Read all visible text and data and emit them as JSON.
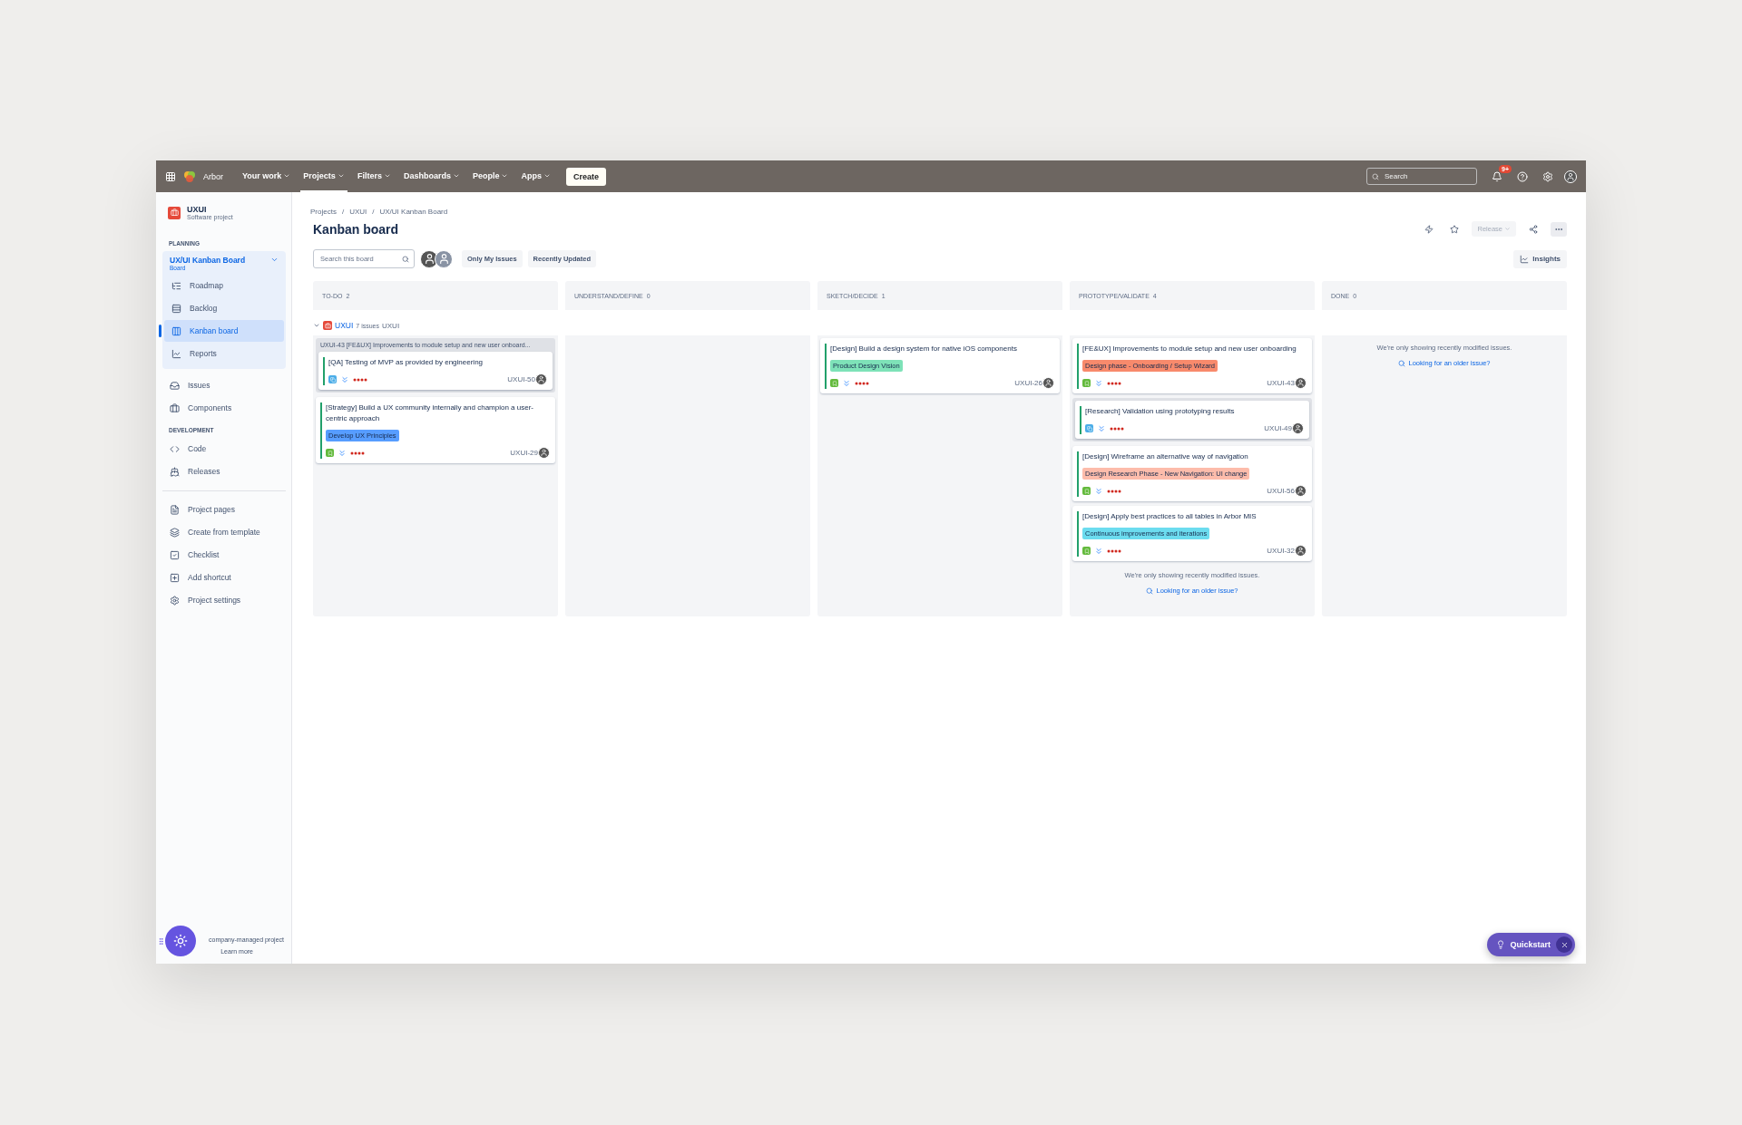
{
  "nav": {
    "brand": "Arbor",
    "items": [
      {
        "label": "Your work",
        "selected": false
      },
      {
        "label": "Projects",
        "selected": true
      },
      {
        "label": "Filters",
        "selected": false
      },
      {
        "label": "Dashboards",
        "selected": false
      },
      {
        "label": "People",
        "selected": false
      },
      {
        "label": "Apps",
        "selected": false
      }
    ],
    "create": "Create",
    "search": {
      "placeholder": "Search"
    },
    "notifications": "9+"
  },
  "sidebar": {
    "project": {
      "name": "UXUI",
      "type": "Software project"
    },
    "sections": [
      {
        "heading": "PLANNING",
        "group": {
          "title": "UX/UI Kanban Board",
          "subtitle": "Board",
          "expanded": true,
          "items": [
            {
              "label": "Roadmap",
              "selected": false
            },
            {
              "label": "Backlog",
              "selected": false
            },
            {
              "label": "Kanban board",
              "selected": true
            },
            {
              "label": "Reports",
              "selected": false
            }
          ]
        },
        "items": [
          {
            "label": "Issues",
            "selected": false
          },
          {
            "label": "Components",
            "selected": false
          }
        ]
      },
      {
        "heading": "DEVELOPMENT",
        "items": [
          {
            "label": "Code",
            "selected": false
          },
          {
            "label": "Releases",
            "selected": false
          }
        ]
      }
    ],
    "links": [
      {
        "label": "Project pages"
      },
      {
        "label": "Create from template"
      },
      {
        "label": "Checklist"
      },
      {
        "label": "Add shortcut"
      },
      {
        "label": "Project settings"
      }
    ],
    "footer": {
      "text": "company-managed project",
      "link": "Learn more"
    }
  },
  "breadcrumbs": [
    "Projects",
    "UXUI",
    "UX/UI Kanban Board"
  ],
  "breadcrumb_separator": "/",
  "title": "Kanban board",
  "actions": {
    "release": "Release",
    "release_disabled": true,
    "insights": "Insights"
  },
  "filters": {
    "search_placeholder": "Search this board",
    "quick": [
      "Only My Issues",
      "Recently Updated"
    ]
  },
  "swimlane": {
    "expanded": true,
    "project": "UXUI",
    "count": "7 issues",
    "name": "UXUI"
  },
  "columns": [
    {
      "name": "TO-DO",
      "count": "2",
      "cards": [
        {
          "kind": "parent",
          "key": "UXUI-43",
          "title": "[FE&UX] Improvements to module setup and new user onboard...",
          "children": [
            {
              "title": "[QA] Testing of MVP as provided by engineering",
              "kind": "subtask",
              "key": "UXUI-50"
            }
          ]
        },
        {
          "kind": "story",
          "title": "[Strategy] Build a UX community internally and champion a user-centric approach",
          "label": {
            "text": "Develop UX Principles",
            "color": "#579dff"
          },
          "key": "UXUI-29"
        }
      ]
    },
    {
      "name": "UNDERSTAND/DEFINE",
      "count": "0"
    },
    {
      "name": "SKETCH/DECIDE",
      "count": "1",
      "cards": [
        {
          "kind": "story",
          "title": "[Design] Build a design system for native iOS components",
          "label": {
            "text": "Product Design Vision",
            "color": "#7ee2b8"
          },
          "key": "UXUI-26"
        }
      ]
    },
    {
      "name": "PROTOTYPE/VALIDATE",
      "count": "4",
      "cards": [
        {
          "kind": "story",
          "title": "[FE&UX] Improvements to module setup and new user onboarding",
          "label": {
            "text": "Design phase - Onboarding / Setup Wizard",
            "color": "#f88a6c"
          },
          "key": "UXUI-43"
        },
        {
          "kind": "parent",
          "children": [
            {
              "title": "[Research] Validation using prototyping results",
              "kind": "subtask",
              "key": "UXUI-49"
            }
          ]
        },
        {
          "kind": "story",
          "title": "[Design] Wireframe an alternative way of navigation",
          "label": {
            "text": "Design Research Phase - New Navigation: UI change",
            "color": "#fdbcab"
          },
          "key": "UXUI-56"
        },
        {
          "kind": "story",
          "title": "[Design] Apply best practices to all tables in Arbor MIS",
          "label": {
            "text": "Continuous improvements and iterations",
            "color": "#6cdcef"
          },
          "key": "UXUI-32"
        }
      ],
      "notice": {
        "text": "We're only showing recently modified issues.",
        "link": "Looking for an older issue?"
      }
    },
    {
      "name": "DONE",
      "count": "0",
      "notice": {
        "text": "We're only showing recently modified issues.",
        "link": "Looking for an older issue?"
      }
    }
  ],
  "quickstart": "Quickstart"
}
